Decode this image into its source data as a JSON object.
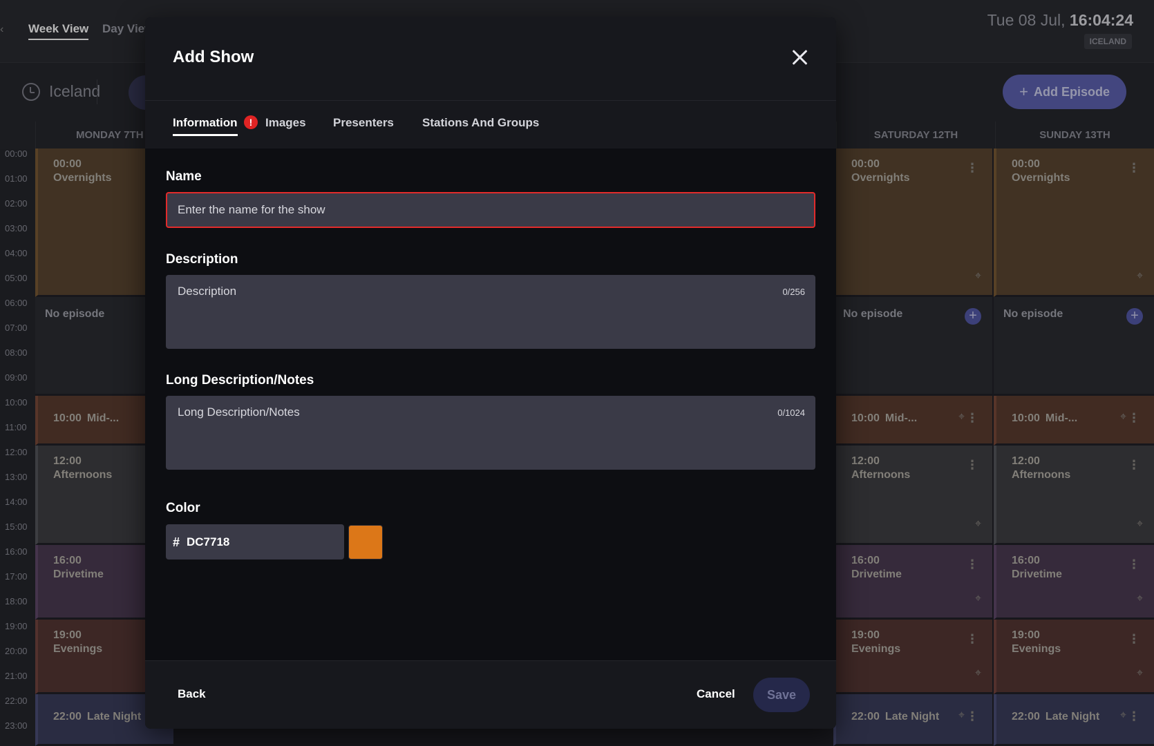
{
  "app": {
    "tabs": {
      "week": "Week View",
      "day": "Day View"
    },
    "clock": {
      "date": "Tue 08 Jul,",
      "time": "16:04:24",
      "zone_badge": "ICELAND"
    },
    "timezone_label": "Iceland",
    "add_episode_label": "Add Episode",
    "days": [
      "MONDAY 7TH",
      "SATURDAY 12TH",
      "SUNDAY 13TH"
    ],
    "hours": [
      "00:00",
      "01:00",
      "02:00",
      "03:00",
      "04:00",
      "05:00",
      "06:00",
      "07:00",
      "08:00",
      "09:00",
      "10:00",
      "11:00",
      "12:00",
      "13:00",
      "14:00",
      "15:00",
      "16:00",
      "17:00",
      "18:00",
      "19:00",
      "20:00",
      "21:00",
      "22:00",
      "23:00"
    ],
    "blocks": {
      "overnights": {
        "time": "00:00",
        "name": "Overnights"
      },
      "no_episode": "No episode",
      "mid": {
        "time": "10:00",
        "name": "Mid-..."
      },
      "afternoons": {
        "time": "12:00",
        "name": "Afternoons"
      },
      "drivetime": {
        "time": "16:00",
        "name": "Drivetime"
      },
      "evenings": {
        "time": "19:00",
        "name": "Evenings"
      },
      "late_night": {
        "time": "22:00",
        "name": "Late Night"
      }
    }
  },
  "modal": {
    "title": "Add Show",
    "tabs": {
      "information": "Information",
      "error_badge": "!",
      "images": "Images",
      "presenters": "Presenters",
      "stations": "Stations And Groups"
    },
    "fields": {
      "name_label": "Name",
      "name_placeholder": "Enter the name for the show",
      "description_label": "Description",
      "description_placeholder": "Description",
      "description_counter": "0/256",
      "long_label": "Long Description/Notes",
      "long_placeholder": "Long Description/Notes",
      "long_counter": "0/1024",
      "color_label": "Color",
      "color_hash": "#",
      "color_value": "DC7718"
    },
    "footer": {
      "back": "Back",
      "cancel": "Cancel",
      "save": "Save"
    }
  },
  "colors": {
    "swatch": "#DC7718",
    "error": "#e22b2b",
    "accent": "#5d62b0"
  }
}
